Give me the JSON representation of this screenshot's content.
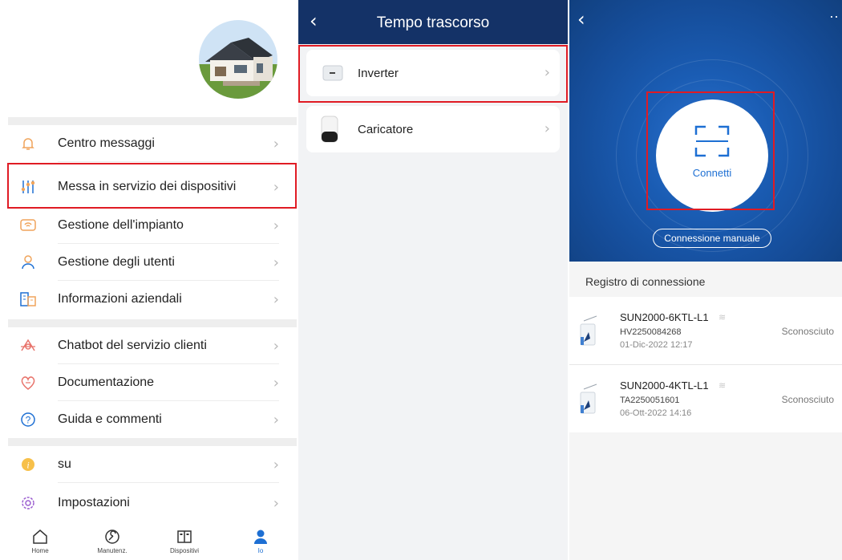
{
  "panel1": {
    "menu_groups": [
      {
        "items": [
          {
            "label": "Centro messaggi",
            "icon": "bell-icon"
          },
          {
            "label": "Messa in servizio dei dispositivi",
            "icon": "sliders-icon"
          },
          {
            "label": "Gestione dell'impianto",
            "icon": "plant-icon"
          },
          {
            "label": "Gestione degli utenti",
            "icon": "user-icon"
          },
          {
            "label": "Informazioni aziendali",
            "icon": "building-icon"
          }
        ]
      },
      {
        "items": [
          {
            "label": "Chatbot del servizio clienti",
            "icon": "chatbot-icon"
          },
          {
            "label": "Documentazione",
            "icon": "document-icon"
          },
          {
            "label": "Guida e commenti",
            "icon": "help-icon"
          }
        ]
      },
      {
        "items": [
          {
            "label": "su",
            "icon": "info-icon"
          },
          {
            "label": "Impostazioni",
            "icon": "settings-icon"
          }
        ]
      }
    ],
    "tabs": [
      {
        "label": "Home",
        "icon": "home-icon"
      },
      {
        "label": "Manutenz.",
        "icon": "maintenance-icon"
      },
      {
        "label": "Dispositivi",
        "icon": "devices-icon"
      },
      {
        "label": "Io",
        "icon": "person-icon",
        "active": true
      }
    ]
  },
  "panel2": {
    "title": "Tempo trascorso",
    "items": [
      {
        "label": "Inverter",
        "icon": "inverter-icon"
      },
      {
        "label": "Caricatore",
        "icon": "charger-icon"
      }
    ]
  },
  "panel3": {
    "connect_label": "Connetti",
    "manual_label": "Connessione manuale",
    "registry_title": "Registro di connessione",
    "devices": [
      {
        "model": "SUN2000-6KTL-L1",
        "serial": "HV2250084268",
        "date": "01-Dic-2022 12:17",
        "status": "Sconosciuto"
      },
      {
        "model": "SUN2000-4KTL-L1",
        "serial": "TA2250051601",
        "date": "06-Ott-2022 14:16",
        "status": "Sconosciuto"
      }
    ]
  },
  "colors": {
    "accent_orange": "#f0a45b",
    "primary_blue": "#1d6fd3",
    "header_navy": "#143267",
    "highlight_red": "#e01b24"
  }
}
